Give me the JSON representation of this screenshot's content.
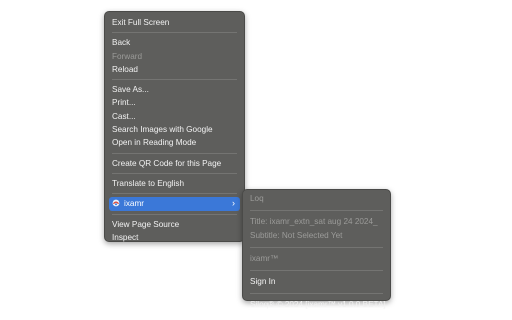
{
  "main_menu": {
    "group1": [
      {
        "label": "Exit Full Screen",
        "disabled": false
      }
    ],
    "group2": [
      {
        "label": "Back",
        "disabled": false
      },
      {
        "label": "Forward",
        "disabled": true
      },
      {
        "label": "Reload",
        "disabled": false
      }
    ],
    "group3": [
      {
        "label": "Save As...",
        "disabled": false
      },
      {
        "label": "Print...",
        "disabled": false
      },
      {
        "label": "Cast...",
        "disabled": false
      },
      {
        "label": "Search Images with Google",
        "disabled": false
      },
      {
        "label": "Open in Reading Mode",
        "disabled": false
      }
    ],
    "group4": [
      {
        "label": "Create QR Code for this Page",
        "disabled": false
      }
    ],
    "group5": [
      {
        "label": "Translate to English",
        "disabled": false
      }
    ],
    "extension": {
      "label": "ixamr",
      "chevron": "›",
      "icon": "extension-logo-icon",
      "accent": "#3b78d8"
    },
    "group7": [
      {
        "label": "View Page Source",
        "disabled": false
      },
      {
        "label": "Inspect",
        "disabled": false
      }
    ]
  },
  "sub_menu": {
    "header": "Loq",
    "title_line": "Title: ixamr_extn_sat aug 24 2024_",
    "subtitle_line": "Subtitle: Not Selected Yet",
    "brand": "ixamr™",
    "sign_in": "Sign In",
    "footer": "Siloq® © 2024 [ixamr™ v1.0.0 BETA]"
  }
}
